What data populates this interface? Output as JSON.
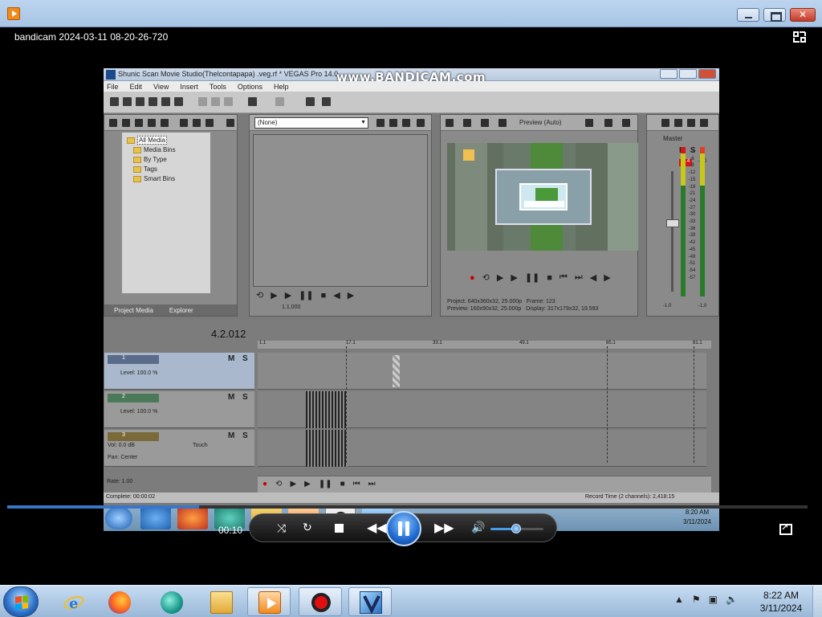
{
  "player": {
    "window_icon": "bandicam-player-icon",
    "recording_title": "bandicam 2024-03-11 08-20-26-720",
    "fullscreen_exit_icon": "collapse-icon",
    "current_time": "00:10",
    "progress_fraction": 0.24,
    "volume_fraction": 0.48,
    "controls": [
      "shuffle-icon",
      "repeat-icon",
      "stop-icon",
      "rewind-icon",
      "pause-icon",
      "fast-forward-icon",
      "volume-icon",
      "fullscreen-icon"
    ]
  },
  "capture": {
    "watermark": "www.BANDICAM.com",
    "vegas": {
      "title": "Shunic Scan Movie Studio(Thelcontapapa) .veg.rf *  VEGAS Pro 14.0",
      "menu": [
        "File",
        "Edit",
        "View",
        "Insert",
        "Tools",
        "Options",
        "Help"
      ],
      "project_media": {
        "tree": [
          "All Media",
          "Media Bins",
          "By Type",
          "Tags",
          "Smart Bins"
        ],
        "tabs": [
          "Project Media",
          "Explorer"
        ]
      },
      "trimmer": {
        "dropdown_value": "(None)",
        "timecode": "1.1.000"
      },
      "preview": {
        "mode": "Preview (Auto)",
        "project_label": "Project:",
        "project_value": "640x360x32, 25.000p",
        "preview_label": "Preview:",
        "preview_value": "160x90x32, 25.000p",
        "frame_label": "Frame:",
        "frame_value": "123",
        "display_label": "Display:",
        "display_value": "317x179x32, 19.593"
      },
      "master": {
        "label": "Master",
        "peak_left": "-6.4",
        "peak_right": "-1.0",
        "scale": [
          "-3",
          "-6",
          "-9",
          "-12",
          "-15",
          "-18",
          "-21",
          "-24",
          "-27",
          "-30",
          "-33",
          "-36",
          "-39",
          "-42",
          "-45",
          "-48",
          "-51",
          "-54",
          "-57"
        ],
        "bottom_left": "-1.0",
        "bottom_right": "-1.0"
      },
      "timeline": {
        "cursor_time": "4.2.012",
        "ruler_marks": [
          "1.1",
          "17.1",
          "33.1",
          "49.1",
          "65.1",
          "81.1"
        ],
        "tracks": [
          {
            "number": "1",
            "level_label": "Level: 100.0 %",
            "mute": "M",
            "solo": "S"
          },
          {
            "number": "2",
            "level_label": "Level: 100.0 %",
            "mute": "M",
            "solo": "S"
          },
          {
            "number": "3",
            "vol_label": "Vol:",
            "vol_value": "0.0 dB",
            "pan_label": "Pan:",
            "pan_value": "Center",
            "touch_label": "Touch",
            "mute": "M",
            "solo": "S"
          }
        ],
        "rate_label": "Rate: 1.00",
        "status_left": "Complete: 00:00:02",
        "status_right": "Record Time (2 channels): 2,418:15"
      },
      "inner_clock": {
        "time": "8:20 AM",
        "date": "3/11/2024"
      }
    }
  },
  "taskbar": {
    "apps": [
      "internet-explorer-icon",
      "firefox-icon",
      "chat-app-icon",
      "file-explorer-icon",
      "media-player-icon",
      "bandicam-icon",
      "vegas-icon"
    ],
    "clock_time": "8:22 AM",
    "clock_date": "3/11/2024"
  }
}
